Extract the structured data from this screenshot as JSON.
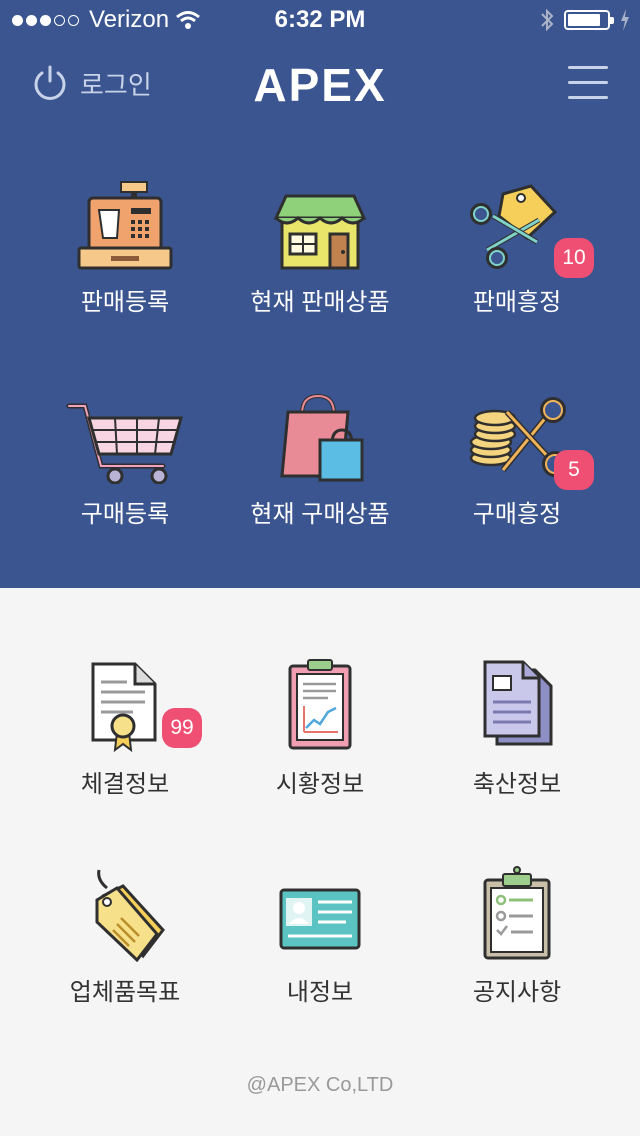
{
  "status_bar": {
    "carrier": "Verizon",
    "time": "6:32 PM"
  },
  "header": {
    "login_label": "로그인",
    "brand": "APEX"
  },
  "top_grid": [
    {
      "label": "판매등록"
    },
    {
      "label": "현재 판매상품"
    },
    {
      "label": "판매흥정",
      "badge": "10"
    },
    {
      "label": "구매등록"
    },
    {
      "label": "현재 구매상품"
    },
    {
      "label": "구매흥정",
      "badge": "5"
    }
  ],
  "bottom_grid": [
    {
      "label": "체결정보",
      "badge": "99"
    },
    {
      "label": "시황정보"
    },
    {
      "label": "축산정보"
    },
    {
      "label": "업체품목표"
    },
    {
      "label": "내정보"
    },
    {
      "label": "공지사항"
    }
  ],
  "footer": "@APEX Co,LTD",
  "colors": {
    "top_bg": "#3b5590",
    "bottom_bg": "#f5f5f5",
    "badge": "#ef4f72"
  }
}
